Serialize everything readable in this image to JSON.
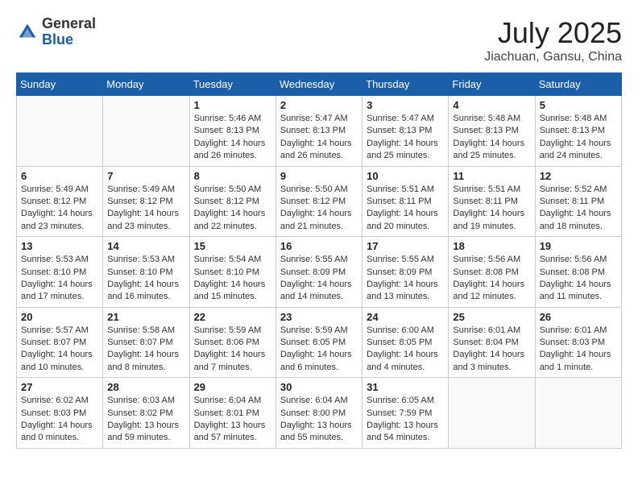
{
  "header": {
    "logo_general": "General",
    "logo_blue": "Blue",
    "month": "July 2025",
    "location": "Jiachuan, Gansu, China"
  },
  "days_of_week": [
    "Sunday",
    "Monday",
    "Tuesday",
    "Wednesday",
    "Thursday",
    "Friday",
    "Saturday"
  ],
  "weeks": [
    [
      {
        "day": "",
        "info": ""
      },
      {
        "day": "",
        "info": ""
      },
      {
        "day": "1",
        "info": "Sunrise: 5:46 AM\nSunset: 8:13 PM\nDaylight: 14 hours and 26 minutes."
      },
      {
        "day": "2",
        "info": "Sunrise: 5:47 AM\nSunset: 8:13 PM\nDaylight: 14 hours and 26 minutes."
      },
      {
        "day": "3",
        "info": "Sunrise: 5:47 AM\nSunset: 8:13 PM\nDaylight: 14 hours and 25 minutes."
      },
      {
        "day": "4",
        "info": "Sunrise: 5:48 AM\nSunset: 8:13 PM\nDaylight: 14 hours and 25 minutes."
      },
      {
        "day": "5",
        "info": "Sunrise: 5:48 AM\nSunset: 8:13 PM\nDaylight: 14 hours and 24 minutes."
      }
    ],
    [
      {
        "day": "6",
        "info": "Sunrise: 5:49 AM\nSunset: 8:12 PM\nDaylight: 14 hours and 23 minutes."
      },
      {
        "day": "7",
        "info": "Sunrise: 5:49 AM\nSunset: 8:12 PM\nDaylight: 14 hours and 23 minutes."
      },
      {
        "day": "8",
        "info": "Sunrise: 5:50 AM\nSunset: 8:12 PM\nDaylight: 14 hours and 22 minutes."
      },
      {
        "day": "9",
        "info": "Sunrise: 5:50 AM\nSunset: 8:12 PM\nDaylight: 14 hours and 21 minutes."
      },
      {
        "day": "10",
        "info": "Sunrise: 5:51 AM\nSunset: 8:11 PM\nDaylight: 14 hours and 20 minutes."
      },
      {
        "day": "11",
        "info": "Sunrise: 5:51 AM\nSunset: 8:11 PM\nDaylight: 14 hours and 19 minutes."
      },
      {
        "day": "12",
        "info": "Sunrise: 5:52 AM\nSunset: 8:11 PM\nDaylight: 14 hours and 18 minutes."
      }
    ],
    [
      {
        "day": "13",
        "info": "Sunrise: 5:53 AM\nSunset: 8:10 PM\nDaylight: 14 hours and 17 minutes."
      },
      {
        "day": "14",
        "info": "Sunrise: 5:53 AM\nSunset: 8:10 PM\nDaylight: 14 hours and 16 minutes."
      },
      {
        "day": "15",
        "info": "Sunrise: 5:54 AM\nSunset: 8:10 PM\nDaylight: 14 hours and 15 minutes."
      },
      {
        "day": "16",
        "info": "Sunrise: 5:55 AM\nSunset: 8:09 PM\nDaylight: 14 hours and 14 minutes."
      },
      {
        "day": "17",
        "info": "Sunrise: 5:55 AM\nSunset: 8:09 PM\nDaylight: 14 hours and 13 minutes."
      },
      {
        "day": "18",
        "info": "Sunrise: 5:56 AM\nSunset: 8:08 PM\nDaylight: 14 hours and 12 minutes."
      },
      {
        "day": "19",
        "info": "Sunrise: 5:56 AM\nSunset: 8:08 PM\nDaylight: 14 hours and 11 minutes."
      }
    ],
    [
      {
        "day": "20",
        "info": "Sunrise: 5:57 AM\nSunset: 8:07 PM\nDaylight: 14 hours and 10 minutes."
      },
      {
        "day": "21",
        "info": "Sunrise: 5:58 AM\nSunset: 8:07 PM\nDaylight: 14 hours and 8 minutes."
      },
      {
        "day": "22",
        "info": "Sunrise: 5:59 AM\nSunset: 8:06 PM\nDaylight: 14 hours and 7 minutes."
      },
      {
        "day": "23",
        "info": "Sunrise: 5:59 AM\nSunset: 8:05 PM\nDaylight: 14 hours and 6 minutes."
      },
      {
        "day": "24",
        "info": "Sunrise: 6:00 AM\nSunset: 8:05 PM\nDaylight: 14 hours and 4 minutes."
      },
      {
        "day": "25",
        "info": "Sunrise: 6:01 AM\nSunset: 8:04 PM\nDaylight: 14 hours and 3 minutes."
      },
      {
        "day": "26",
        "info": "Sunrise: 6:01 AM\nSunset: 8:03 PM\nDaylight: 14 hours and 1 minute."
      }
    ],
    [
      {
        "day": "27",
        "info": "Sunrise: 6:02 AM\nSunset: 8:03 PM\nDaylight: 14 hours and 0 minutes."
      },
      {
        "day": "28",
        "info": "Sunrise: 6:03 AM\nSunset: 8:02 PM\nDaylight: 13 hours and 59 minutes."
      },
      {
        "day": "29",
        "info": "Sunrise: 6:04 AM\nSunset: 8:01 PM\nDaylight: 13 hours and 57 minutes."
      },
      {
        "day": "30",
        "info": "Sunrise: 6:04 AM\nSunset: 8:00 PM\nDaylight: 13 hours and 55 minutes."
      },
      {
        "day": "31",
        "info": "Sunrise: 6:05 AM\nSunset: 7:59 PM\nDaylight: 13 hours and 54 minutes."
      },
      {
        "day": "",
        "info": ""
      },
      {
        "day": "",
        "info": ""
      }
    ]
  ]
}
